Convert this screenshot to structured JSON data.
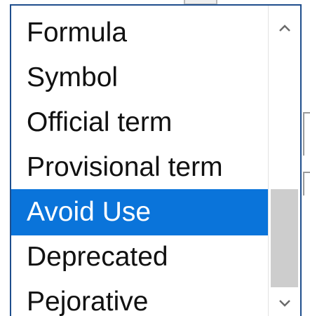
{
  "dropdown": {
    "items": [
      {
        "label": "Formula",
        "selected": false
      },
      {
        "label": "Symbol",
        "selected": false
      },
      {
        "label": "Official term",
        "selected": false
      },
      {
        "label": "Provisional term",
        "selected": false
      },
      {
        "label": "Avoid Use",
        "selected": true
      },
      {
        "label": "Deprecated",
        "selected": false
      },
      {
        "label": "Pejorative",
        "selected": false
      }
    ],
    "selected_value": "Avoid Use"
  },
  "scrollbar": {
    "up_icon": "chevron-up-icon",
    "down_icon": "chevron-down-icon"
  },
  "colors": {
    "selection_background": "#0a74da",
    "selection_text": "#ffffff",
    "item_text": "#111111",
    "border": "#1f4e8c",
    "scroll_thumb": "#cdcdcd"
  }
}
